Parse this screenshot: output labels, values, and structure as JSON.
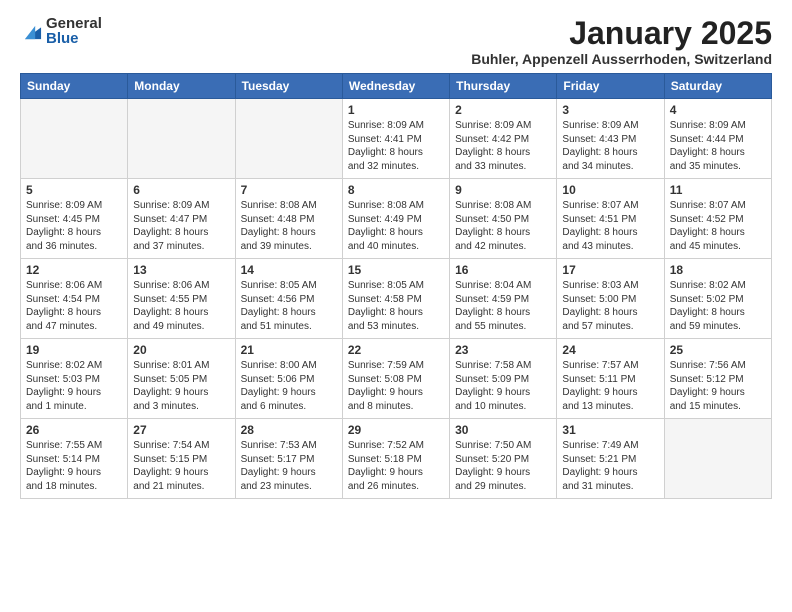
{
  "logo": {
    "general": "General",
    "blue": "Blue"
  },
  "header": {
    "title": "January 2025",
    "subtitle": "Buhler, Appenzell Ausserrhoden, Switzerland"
  },
  "days": [
    "Sunday",
    "Monday",
    "Tuesday",
    "Wednesday",
    "Thursday",
    "Friday",
    "Saturday"
  ],
  "rows": [
    [
      {
        "date": "",
        "info": "",
        "empty": true
      },
      {
        "date": "",
        "info": "",
        "empty": true
      },
      {
        "date": "",
        "info": "",
        "empty": true
      },
      {
        "date": "1",
        "info": "Sunrise: 8:09 AM\nSunset: 4:41 PM\nDaylight: 8 hours\nand 32 minutes."
      },
      {
        "date": "2",
        "info": "Sunrise: 8:09 AM\nSunset: 4:42 PM\nDaylight: 8 hours\nand 33 minutes."
      },
      {
        "date": "3",
        "info": "Sunrise: 8:09 AM\nSunset: 4:43 PM\nDaylight: 8 hours\nand 34 minutes."
      },
      {
        "date": "4",
        "info": "Sunrise: 8:09 AM\nSunset: 4:44 PM\nDaylight: 8 hours\nand 35 minutes."
      }
    ],
    [
      {
        "date": "5",
        "info": "Sunrise: 8:09 AM\nSunset: 4:45 PM\nDaylight: 8 hours\nand 36 minutes."
      },
      {
        "date": "6",
        "info": "Sunrise: 8:09 AM\nSunset: 4:47 PM\nDaylight: 8 hours\nand 37 minutes."
      },
      {
        "date": "7",
        "info": "Sunrise: 8:08 AM\nSunset: 4:48 PM\nDaylight: 8 hours\nand 39 minutes."
      },
      {
        "date": "8",
        "info": "Sunrise: 8:08 AM\nSunset: 4:49 PM\nDaylight: 8 hours\nand 40 minutes."
      },
      {
        "date": "9",
        "info": "Sunrise: 8:08 AM\nSunset: 4:50 PM\nDaylight: 8 hours\nand 42 minutes."
      },
      {
        "date": "10",
        "info": "Sunrise: 8:07 AM\nSunset: 4:51 PM\nDaylight: 8 hours\nand 43 minutes."
      },
      {
        "date": "11",
        "info": "Sunrise: 8:07 AM\nSunset: 4:52 PM\nDaylight: 8 hours\nand 45 minutes."
      }
    ],
    [
      {
        "date": "12",
        "info": "Sunrise: 8:06 AM\nSunset: 4:54 PM\nDaylight: 8 hours\nand 47 minutes."
      },
      {
        "date": "13",
        "info": "Sunrise: 8:06 AM\nSunset: 4:55 PM\nDaylight: 8 hours\nand 49 minutes."
      },
      {
        "date": "14",
        "info": "Sunrise: 8:05 AM\nSunset: 4:56 PM\nDaylight: 8 hours\nand 51 minutes."
      },
      {
        "date": "15",
        "info": "Sunrise: 8:05 AM\nSunset: 4:58 PM\nDaylight: 8 hours\nand 53 minutes."
      },
      {
        "date": "16",
        "info": "Sunrise: 8:04 AM\nSunset: 4:59 PM\nDaylight: 8 hours\nand 55 minutes."
      },
      {
        "date": "17",
        "info": "Sunrise: 8:03 AM\nSunset: 5:00 PM\nDaylight: 8 hours\nand 57 minutes."
      },
      {
        "date": "18",
        "info": "Sunrise: 8:02 AM\nSunset: 5:02 PM\nDaylight: 8 hours\nand 59 minutes."
      }
    ],
    [
      {
        "date": "19",
        "info": "Sunrise: 8:02 AM\nSunset: 5:03 PM\nDaylight: 9 hours\nand 1 minute."
      },
      {
        "date": "20",
        "info": "Sunrise: 8:01 AM\nSunset: 5:05 PM\nDaylight: 9 hours\nand 3 minutes."
      },
      {
        "date": "21",
        "info": "Sunrise: 8:00 AM\nSunset: 5:06 PM\nDaylight: 9 hours\nand 6 minutes."
      },
      {
        "date": "22",
        "info": "Sunrise: 7:59 AM\nSunset: 5:08 PM\nDaylight: 9 hours\nand 8 minutes."
      },
      {
        "date": "23",
        "info": "Sunrise: 7:58 AM\nSunset: 5:09 PM\nDaylight: 9 hours\nand 10 minutes."
      },
      {
        "date": "24",
        "info": "Sunrise: 7:57 AM\nSunset: 5:11 PM\nDaylight: 9 hours\nand 13 minutes."
      },
      {
        "date": "25",
        "info": "Sunrise: 7:56 AM\nSunset: 5:12 PM\nDaylight: 9 hours\nand 15 minutes."
      }
    ],
    [
      {
        "date": "26",
        "info": "Sunrise: 7:55 AM\nSunset: 5:14 PM\nDaylight: 9 hours\nand 18 minutes."
      },
      {
        "date": "27",
        "info": "Sunrise: 7:54 AM\nSunset: 5:15 PM\nDaylight: 9 hours\nand 21 minutes."
      },
      {
        "date": "28",
        "info": "Sunrise: 7:53 AM\nSunset: 5:17 PM\nDaylight: 9 hours\nand 23 minutes."
      },
      {
        "date": "29",
        "info": "Sunrise: 7:52 AM\nSunset: 5:18 PM\nDaylight: 9 hours\nand 26 minutes."
      },
      {
        "date": "30",
        "info": "Sunrise: 7:50 AM\nSunset: 5:20 PM\nDaylight: 9 hours\nand 29 minutes."
      },
      {
        "date": "31",
        "info": "Sunrise: 7:49 AM\nSunset: 5:21 PM\nDaylight: 9 hours\nand 31 minutes."
      },
      {
        "date": "",
        "info": "",
        "empty": true
      }
    ]
  ]
}
